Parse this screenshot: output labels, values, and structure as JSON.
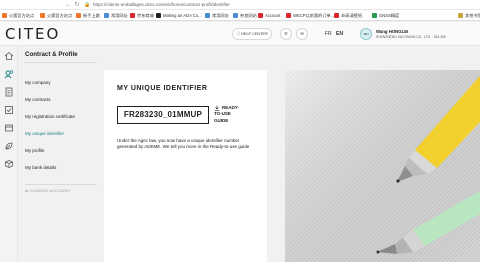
{
  "browser": {
    "url": "https://clients-emballages.citeo.com/en/home/contract-profil/identifier",
    "bookmarks": [
      {
        "label": "火狐官方站点",
        "color": "#f0772a"
      },
      {
        "label": "火狐官方站点",
        "color": "#f0772a"
      },
      {
        "label": "新手上路",
        "color": "#f0772a"
      },
      {
        "label": "常用网址",
        "color": "#4a8bd6"
      },
      {
        "label": "京东商城",
        "color": "#d9262a"
      },
      {
        "label": "Making an ADA Co...",
        "color": "#222222"
      },
      {
        "label": "常用网址",
        "color": "#4a8bd6"
      },
      {
        "label": "奈良网站",
        "color": "#4a8bd6"
      },
      {
        "label": "Account",
        "color": "#d9262a"
      },
      {
        "label": "WECP以前我的订单...",
        "color": "#d9262a"
      },
      {
        "label": "4k高清壁纸",
        "color": "#d9262a"
      },
      {
        "label": "GNSS精度",
        "color": "#2a9c52"
      },
      {
        "label": "其他书签",
        "color": "#c9a43a"
      }
    ]
  },
  "header": {
    "logo": "CITEO",
    "help_center": "HELP CENTER",
    "lang_fr": "FR",
    "lang_en": "EN",
    "avatar_initials": "WH",
    "user_name": "Wang HONGLEI",
    "user_company": "SHENZHENG SUCI BIGIN CO., LTD. - 344 309"
  },
  "sidebar": {
    "title": "Contract & Profile",
    "items": [
      {
        "label": "My company"
      },
      {
        "label": "My contracts"
      },
      {
        "label": "My registration certificate"
      },
      {
        "label": "My unique identifier"
      },
      {
        "label": "My profile"
      },
      {
        "label": "My bank details"
      }
    ],
    "change_account": "CHANGE ACCOUNT"
  },
  "card": {
    "title": "MY UNIQUE IDENTIFIER",
    "identifier": "FR283230_01MMUP",
    "download_label": "READY-TO-USE GUIDE",
    "description": "Under the Agec law, you now have a unique identifier number generated by ADEME. We tell you more in the Ready-to-use guide"
  },
  "colors": {
    "accent": "#1c7e88",
    "pen_yellow": "#f2d12e",
    "pen_green": "#b8e6c1"
  },
  "icons": [
    "refresh-icon",
    "back-icon",
    "shield-icon",
    "lock-icon",
    "help-icon",
    "phone-icon",
    "mail-icon",
    "download-icon"
  ]
}
